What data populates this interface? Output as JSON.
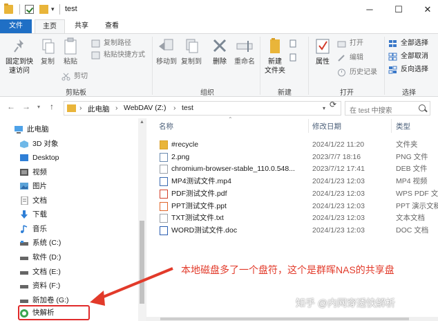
{
  "window": {
    "title": "test",
    "controls": {
      "minimize": "─",
      "maximize": "☐",
      "close": "✕"
    }
  },
  "ribbon_tabs": [
    "文件",
    "主页",
    "共享",
    "查看"
  ],
  "ribbon": {
    "clipboard": {
      "pin_label": "固定到快速访问",
      "copy_label": "复制",
      "paste_label": "粘贴",
      "copy_path": "复制路径",
      "paste_shortcut": "粘贴快捷方式",
      "cut": "剪切",
      "group_label": "剪贴板"
    },
    "organize": {
      "move_to": "移动到",
      "copy_to": "复制到",
      "delete": "删除",
      "rename": "重命名",
      "group_label": "组织"
    },
    "new": {
      "new_folder": "新建\n文件夹",
      "group_label": "新建"
    },
    "open": {
      "properties": "属性",
      "open": "打开",
      "edit": "编辑",
      "history": "历史记录",
      "group_label": "打开"
    },
    "select": {
      "select_all": "全部选择",
      "select_none": "全部取消",
      "invert": "反向选择",
      "group_label": "选择"
    }
  },
  "address": {
    "crumbs": [
      "此电脑",
      "WebDAV (Z:)",
      "test"
    ],
    "search_placeholder": "在 test 中搜索"
  },
  "nav": {
    "items": [
      {
        "label": "此电脑",
        "icon": "pc-icon"
      },
      {
        "label": "3D 对象",
        "icon": "cube-icon"
      },
      {
        "label": "Desktop",
        "icon": "desktop-icon"
      },
      {
        "label": "视频",
        "icon": "video-icon"
      },
      {
        "label": "图片",
        "icon": "picture-icon"
      },
      {
        "label": "文档",
        "icon": "document-icon"
      },
      {
        "label": "下载",
        "icon": "download-icon"
      },
      {
        "label": "音乐",
        "icon": "music-icon"
      },
      {
        "label": "系统 (C:)",
        "icon": "drive-icon"
      },
      {
        "label": "软件 (D:)",
        "icon": "drive-icon"
      },
      {
        "label": "文档 (E:)",
        "icon": "drive-icon"
      },
      {
        "label": "资料 (F:)",
        "icon": "drive-icon"
      },
      {
        "label": "新加卷 (G:)",
        "icon": "drive-icon"
      },
      {
        "label": "快解析",
        "icon": "network-drive-icon"
      }
    ]
  },
  "files": {
    "columns": [
      "名称",
      "修改日期",
      "类型"
    ],
    "rows": [
      {
        "name": "#recycle",
        "date": "2024/1/22 11:20",
        "type": "文件夹",
        "icon": "folder-icon"
      },
      {
        "name": "2.png",
        "date": "2023/7/7 18:16",
        "type": "PNG 文件",
        "icon": "image-file-icon"
      },
      {
        "name": "chromium-browser-stable_110.0.548...",
        "date": "2023/7/12 17:41",
        "type": "DEB 文件",
        "icon": "file-icon"
      },
      {
        "name": "MP4测试文件.mp4",
        "date": "2024/1/23 12:03",
        "type": "MP4 视频",
        "icon": "video-file-icon"
      },
      {
        "name": "PDF测试文件.pdf",
        "date": "2024/1/23 12:03",
        "type": "WPS PDF 文",
        "icon": "pdf-file-icon"
      },
      {
        "name": "PPT测试文件.ppt",
        "date": "2024/1/23 12:03",
        "type": "PPT 演示文稿",
        "icon": "ppt-file-icon"
      },
      {
        "name": "TXT测试文件.txt",
        "date": "2024/1/23 12:03",
        "type": "文本文档",
        "icon": "text-file-icon"
      },
      {
        "name": "WORD测试文件.doc",
        "date": "2024/1/23 12:03",
        "type": "DOC 文档",
        "icon": "word-file-icon"
      }
    ]
  },
  "annotation": {
    "text": "本地磁盘多了一个盘符，这个是群晖NAS的共享盘",
    "color": "#e23a2a"
  },
  "watermark": "知乎 @内网穿透快解析",
  "colors": {
    "accent": "#1f6fc5",
    "folder": "#e9b53a",
    "highlight": "#e02a2a"
  }
}
